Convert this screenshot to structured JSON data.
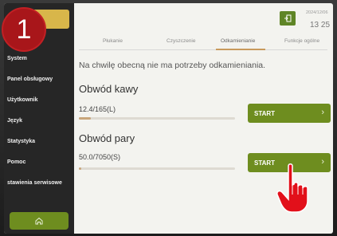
{
  "step_number": "1",
  "sidebar": {
    "items": [
      {
        "label": "System"
      },
      {
        "label": "Panel obsługowy"
      },
      {
        "label": "Użytkownik"
      },
      {
        "label": "Język"
      },
      {
        "label": "Statystyka"
      },
      {
        "label": "Pomoc"
      },
      {
        "label": "stawienia serwisowe"
      }
    ]
  },
  "header": {
    "date": "2024/12/06",
    "time": "13 25"
  },
  "tabs": [
    {
      "label": "Płukanie"
    },
    {
      "label": "Czyszczenie"
    },
    {
      "label": "Odkamienianie",
      "active": true
    },
    {
      "label": "Funkcje ogólne"
    }
  ],
  "notice": "Na chwilę obecną nie ma potrzeby odkamieniania.",
  "circuits": [
    {
      "title": "Obwód kawy",
      "value": "12.4/165(L)",
      "progress": 0.075,
      "button": "START"
    },
    {
      "title": "Obwód pary",
      "value": "50.0/7050(S)",
      "progress": 0.007,
      "button": "START"
    }
  ],
  "colors": {
    "accent_green": "#6e8d1f",
    "badge_red": "#a8161a",
    "sidebar_bg": "#262626",
    "tab_active": "#c89a5c"
  }
}
